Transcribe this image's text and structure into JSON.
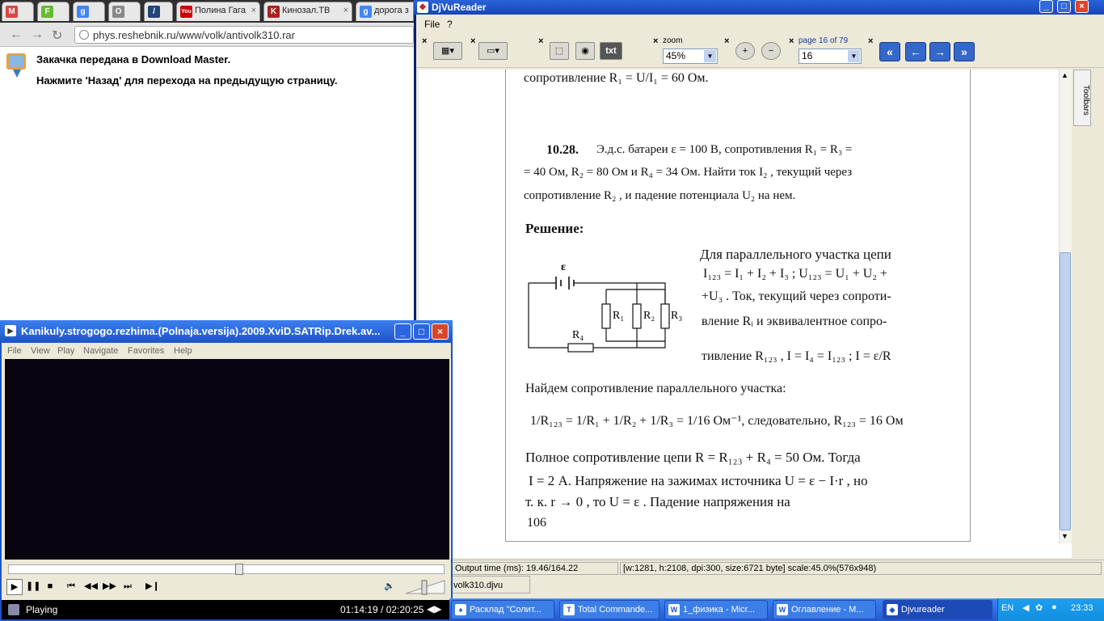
{
  "chrome": {
    "tabs": [
      {
        "label": "",
        "icon": "gmail-icon",
        "color": "#d44"
      },
      {
        "label": "",
        "icon": "feedly-icon",
        "color": "#6b3"
      },
      {
        "label": "",
        "icon": "google-icon",
        "color": "#4285f4"
      },
      {
        "label": "",
        "icon": "odnoklassniki-icon",
        "color": "#888"
      },
      {
        "label": "",
        "icon": "site-icon",
        "color": "#247"
      },
      {
        "label": "Полина Гага",
        "icon": "youtube-icon",
        "color": "#c00"
      },
      {
        "label": "Кинозал.ТВ",
        "icon": "kinozal-icon",
        "color": "#a22"
      },
      {
        "label": "дорога з",
        "icon": "google-icon",
        "color": "#4285f4"
      }
    ],
    "url": "phys.reshebnik.ru/www/volk/antivolk310.rar",
    "message1": "Закачка передана в Download Master.",
    "message2": "Нажмите 'Назад' для перехода на предыдущую страницу."
  },
  "djvu": {
    "title": "DjVuReader",
    "menu": [
      "File",
      "?"
    ],
    "zoom_label": "zoom",
    "zoom_value": "45%",
    "page_label": "page 16 of 79",
    "page_value": "16",
    "txt_button": "txt",
    "sidetab": "Toolbars",
    "status_time": "Output time (ms): 19.46/164.22",
    "status_info": "[w:1281, h:2108, dpi:300, size:6721 byte] scale:45.0%(576x948)",
    "filename": "volk310.djvu"
  },
  "doc": {
    "line0": "сопротивление  R₁ = U/I₁ = 60 Ом.",
    "problem_num": "10.28.",
    "p1": "Э.д.с.   батареи   ε = 100 В,   сопротивления   R₁ = R₃ =",
    "p2": "= 40 Ом,  R₂ = 80 Ом и  R₄ = 34 Ом. Найти ток  I₂ , текущий через",
    "p3": "сопротивление  R₂ , и падение потенциала  U₂  на нем.",
    "solution": "Решение:",
    "s1": "Для  параллельного  участка  цепи",
    "s2": "I₁₂₃ = I₁ + I₂ + I₃ ;      U₁₂₃ = U₁ + U₂ +",
    "s3": "+U₃ . Ток, текущий через сопроти-",
    "s4": "вление  Rᵢ  и  эквивалентное  сопро-",
    "s5": "тивление  R₁₂₃ ,  I = I₄ = I₁₂₃ ;  I = ε/R",
    "s6": "Найдем      сопротивление      параллельного      участка:",
    "s7": "1/R₁₂₃ = 1/R₁ + 1/R₂ + 1/R₃ = 1/16 Ом⁻¹,  следовательно,   R₁₂₃ = 16 Ом",
    "s8": "Полное  сопротивление  цепи   R = R₁₂₃ + R₄ = 50 Ом.  Тогда",
    "s9": "I = 2 А. Напряжение на зажимах источника  U = ε − I·r , но",
    "s10": "т. к.     r → 0 ,     то     U = ε .    Падение    напряжения    на",
    "page_num": "106",
    "circuit": {
      "emf": "ε",
      "r1": "R₁",
      "r2": "R₂",
      "r3": "R₃",
      "r4": "R₄"
    }
  },
  "player": {
    "title": "Kanikuly.strogogo.rezhima.(Polnaja.versija).2009.XviD.SATRip.Drek.av...",
    "menu": [
      "File",
      "View",
      "Play",
      "Navigate",
      "Favorites",
      "Help"
    ],
    "status": "Playing",
    "time": "01:14:19 / 02:20:25",
    "progress": 0.53
  },
  "taskbar": {
    "items": [
      {
        "label": "Расклад \"Солит...",
        "icon": "cards-icon"
      },
      {
        "label": "Total Commande...",
        "icon": "totalcmd-icon"
      },
      {
        "label": "1_физика - Micr...",
        "icon": "word-icon"
      },
      {
        "label": "Оглавление - M...",
        "icon": "word-icon"
      },
      {
        "label": "Djvureader",
        "icon": "djvu-icon"
      }
    ],
    "lang": "EN",
    "clock": "23:33"
  }
}
